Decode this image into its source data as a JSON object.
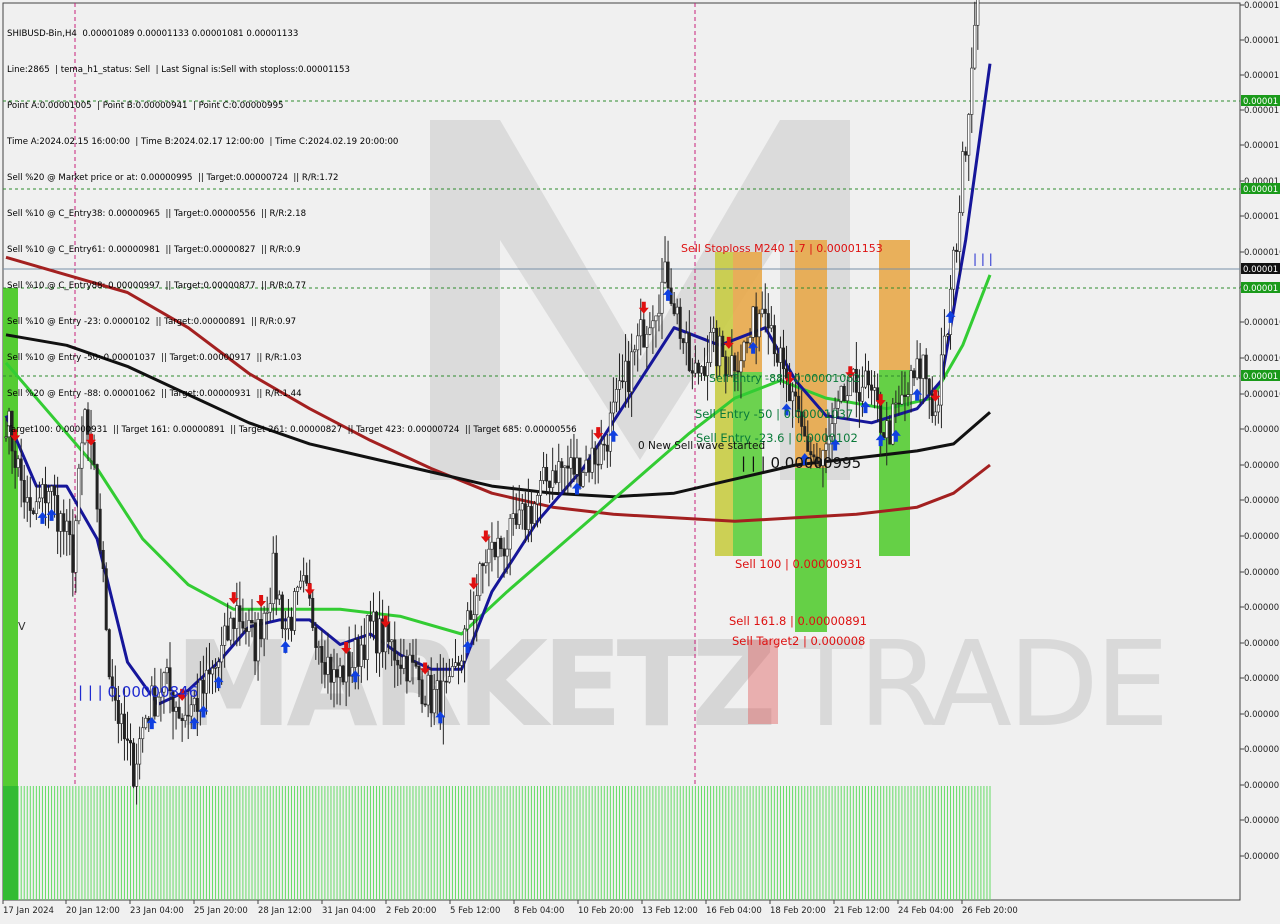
{
  "info_lines": [
    "SHIBUSD-Bin,H4  0.00001089 0.00001133 0.00001081 0.00001133",
    "Line:2865  | tema_h1_status: Sell  | Last Signal is:Sell with stoploss:0.00001153",
    "Point A:0.00001005  | Point B:0.00000941  | Point C:0.00000995",
    "Time A:2024.02.15 16:00:00  | Time B:2024.02.17 12:00:00  | Time C:2024.02.19 20:00:00",
    "Sell %20 @ Market price or at: 0.00000995  || Target:0.00000724  || R/R:1.72",
    "Sell %10 @ C_Entry38: 0.00000965  || Target:0.00000556  || R/R:2.18",
    "Sell %10 @ C_Entry61: 0.00000981  || Target:0.00000827  || R/R:0.9",
    "Sell %10 @ C_Entry88: 0.00000997  || Target:0.00000877  || R/R:0.77",
    "Sell %10 @ Entry -23: 0.0000102  || Target:0.00000891  || R/R:0.97",
    "Sell %10 @ Entry -50: 0.00001037  || Target:0.00000917  || R/R:1.03",
    "Sell %20 @ Entry -88: 0.00001062  || Target:0.00000931  || R/R:1.44",
    "Target100: 0.00000931  || Target 161: 0.00000891  || Target 261: 0.00000827  || Target 423: 0.00000724  || Target 685: 0.00000556"
  ],
  "watermark": {
    "left": "MARKETZ",
    "right": "TRADE"
  },
  "annotations": [
    {
      "id": "stoploss",
      "text": "Sell Stoploss M240 1.7 | 0.00001153",
      "color": "#dd1111"
    },
    {
      "id": "entry88",
      "text": "Sell Entry -88 | 0.00001062",
      "color": "#0a7a3a"
    },
    {
      "id": "entry50",
      "text": "Sell Entry -50 | 0.00001037",
      "color": "#0a7a3a"
    },
    {
      "id": "entry23",
      "text": "Sell Entry -23.6 | 0.0000102",
      "color": "#0a7a3a"
    },
    {
      "id": "wave",
      "text": "0 New Sell wave started",
      "color": "#111111"
    },
    {
      "id": "pointc",
      "text": "| | | 0.00000995",
      "color": "#111111"
    },
    {
      "id": "sell100",
      "text": "Sell 100 | 0.00000931",
      "color": "#dd1111"
    },
    {
      "id": "sell161",
      "text": "Sell 161.8 | 0.00000891",
      "color": "#dd1111"
    },
    {
      "id": "target2",
      "text": "Sell Target2 | 0.000008",
      "color": "#dd1111"
    },
    {
      "id": "low",
      "text": "| | | 0.00000846",
      "color": "#1f2ad0"
    },
    {
      "id": "stopmark",
      "text": "| | |",
      "color": "#1f2ad0"
    },
    {
      "id": "vmark",
      "text": "V",
      "color": "#333333"
    }
  ],
  "price_labels": [
    "0.00001",
    "0.00001",
    "0.00001",
    "0.00001",
    "0.00001",
    "0.00001",
    "0.00001",
    "0.000010",
    "0.000010",
    "0.000010",
    "0.000010",
    "0.000010",
    "0.00000",
    "0.00000",
    "0.00000",
    "0.00000",
    "0.00000",
    "0.00000",
    "0.00000",
    "0.00000",
    "0.00000",
    "0.00000",
    "0.00000",
    "0.00000",
    "0.00000"
  ],
  "tagged_prices": [
    {
      "text": "0.00001",
      "kind": "green"
    },
    {
      "text": "0.00001",
      "kind": "green"
    },
    {
      "text": "0.00001",
      "kind": "current"
    },
    {
      "text": "0.00001",
      "kind": "green"
    },
    {
      "text": "0.00001",
      "kind": "green"
    }
  ],
  "chart_data": {
    "type": "candlestick",
    "symbol": "SHIBUSD-Bin",
    "timeframe": "H4",
    "time_labels": [
      "17 Jan 2024",
      "20 Jan 12:00",
      "23 Jan 04:00",
      "25 Jan 20:00",
      "28 Jan 12:00",
      "31 Jan 04:00",
      "2 Feb 20:00",
      "5 Feb 12:00",
      "8 Feb 04:00",
      "10 Feb 20:00",
      "13 Feb 12:00",
      "16 Feb 04:00",
      "18 Feb 20:00",
      "21 Feb 12:00",
      "24 Feb 04:00",
      "26 Feb 20:00"
    ],
    "ylim": [
      8.1e-06,
      1.21e-05
    ],
    "last": {
      "open": 1.089e-05,
      "high": 1.133e-05,
      "low": 1.081e-05,
      "close": 1.133e-05
    },
    "key_levels": {
      "stoploss": 1.153e-05,
      "entry_88": 1.062e-05,
      "entry_50": 1.037e-05,
      "entry_23_6": 1.02e-05,
      "point_c": 9.95e-06,
      "sell_100": 9.31e-06,
      "sell_161_8": 8.91e-06,
      "target2": 8e-06,
      "swing_low": 8.46e-06
    },
    "price_anchors": [
      [
        0,
        9.6e-06
      ],
      [
        8,
        9.3e-06
      ],
      [
        14,
        9.4e-06
      ],
      [
        22,
        9.2e-06
      ],
      [
        26,
        9.6e-06
      ],
      [
        30,
        9.35e-06
      ],
      [
        34,
        8.9e-06
      ],
      [
        38,
        8.7e-06
      ],
      [
        42,
        8.6e-06
      ],
      [
        46,
        8.75e-06
      ],
      [
        52,
        8.85e-06
      ],
      [
        58,
        8.75e-06
      ],
      [
        64,
        8.8e-06
      ],
      [
        70,
        8.9e-06
      ],
      [
        76,
        9.05e-06
      ],
      [
        82,
        8.95e-06
      ],
      [
        88,
        9.15e-06
      ],
      [
        92,
        9e-06
      ],
      [
        98,
        9.1e-06
      ],
      [
        104,
        8.95e-06
      ],
      [
        108,
        8.85e-06
      ],
      [
        114,
        8.9e-06
      ],
      [
        120,
        9e-06
      ],
      [
        126,
        8.95e-06
      ],
      [
        132,
        8.9e-06
      ],
      [
        140,
        8.8e-06
      ],
      [
        146,
        8.8e-06
      ],
      [
        152,
        9e-06
      ],
      [
        158,
        9.2e-06
      ],
      [
        166,
        9.25e-06
      ],
      [
        174,
        9.35e-06
      ],
      [
        180,
        9.45e-06
      ],
      [
        188,
        9.45e-06
      ],
      [
        196,
        9.5e-06
      ],
      [
        200,
        9.6e-06
      ],
      [
        206,
        9.75e-06
      ],
      [
        212,
        9.9e-06
      ],
      [
        218,
        1e-05
      ],
      [
        226,
        9.7e-06
      ],
      [
        232,
        9.8e-06
      ],
      [
        238,
        9.75e-06
      ],
      [
        244,
        9.8e-06
      ],
      [
        250,
        9.95e-06
      ],
      [
        256,
        9.7e-06
      ],
      [
        262,
        9.55e-06
      ],
      [
        268,
        9.45e-06
      ],
      [
        276,
        9.65e-06
      ],
      [
        282,
        9.7e-06
      ],
      [
        290,
        9.55e-06
      ],
      [
        296,
        9.65e-06
      ],
      [
        302,
        9.75e-06
      ],
      [
        306,
        9.6e-06
      ],
      [
        310,
        9.85e-06
      ],
      [
        314,
        1.02e-05
      ],
      [
        318,
        1.06e-05
      ],
      [
        321,
        1.11e-05
      ],
      [
        324,
        1.133e-05
      ]
    ],
    "moving_averages": [
      {
        "color": "#a32020",
        "points": [
          [
            0,
            1.005e-05
          ],
          [
            20,
            1e-05
          ],
          [
            40,
            9.95e-06
          ],
          [
            60,
            9.85e-06
          ],
          [
            80,
            9.72e-06
          ],
          [
            100,
            9.62e-06
          ],
          [
            120,
            9.53e-06
          ],
          [
            140,
            9.45e-06
          ],
          [
            160,
            9.38e-06
          ],
          [
            180,
            9.34e-06
          ],
          [
            200,
            9.32e-06
          ],
          [
            220,
            9.31e-06
          ],
          [
            240,
            9.3e-06
          ],
          [
            260,
            9.31e-06
          ],
          [
            280,
            9.32e-06
          ],
          [
            300,
            9.34e-06
          ],
          [
            312,
            9.38e-06
          ],
          [
            324,
            9.46e-06
          ]
        ]
      },
      {
        "color": "#111111",
        "points": [
          [
            0,
            9.83e-06
          ],
          [
            20,
            9.8e-06
          ],
          [
            40,
            9.74e-06
          ],
          [
            60,
            9.66e-06
          ],
          [
            80,
            9.58e-06
          ],
          [
            100,
            9.52e-06
          ],
          [
            120,
            9.48e-06
          ],
          [
            140,
            9.44e-06
          ],
          [
            160,
            9.4e-06
          ],
          [
            180,
            9.38e-06
          ],
          [
            200,
            9.37e-06
          ],
          [
            220,
            9.38e-06
          ],
          [
            240,
            9.42e-06
          ],
          [
            260,
            9.46e-06
          ],
          [
            280,
            9.48e-06
          ],
          [
            300,
            9.5e-06
          ],
          [
            312,
            9.52e-06
          ],
          [
            324,
            9.61e-06
          ]
        ]
      },
      {
        "color": "#33cc33",
        "points": [
          [
            0,
            9.75e-06
          ],
          [
            15,
            9.6e-06
          ],
          [
            30,
            9.45e-06
          ],
          [
            45,
            9.25e-06
          ],
          [
            60,
            9.12e-06
          ],
          [
            75,
            9.05e-06
          ],
          [
            90,
            9.05e-06
          ],
          [
            110,
            9.05e-06
          ],
          [
            130,
            9.03e-06
          ],
          [
            150,
            8.98e-06
          ],
          [
            165,
            9.1e-06
          ],
          [
            185,
            9.25e-06
          ],
          [
            205,
            9.4e-06
          ],
          [
            225,
            9.55e-06
          ],
          [
            240,
            9.65e-06
          ],
          [
            255,
            9.7e-06
          ],
          [
            270,
            9.65e-06
          ],
          [
            290,
            9.62e-06
          ],
          [
            305,
            9.65e-06
          ],
          [
            315,
            9.8e-06
          ],
          [
            324,
            1e-05
          ]
        ]
      },
      {
        "color": "#16169a",
        "points": [
          [
            0,
            9.6e-06
          ],
          [
            10,
            9.4e-06
          ],
          [
            20,
            9.4e-06
          ],
          [
            30,
            9.25e-06
          ],
          [
            40,
            8.9e-06
          ],
          [
            50,
            8.78e-06
          ],
          [
            60,
            8.82e-06
          ],
          [
            70,
            8.9e-06
          ],
          [
            80,
            9e-06
          ],
          [
            90,
            9.02e-06
          ],
          [
            100,
            9.02e-06
          ],
          [
            110,
            8.95e-06
          ],
          [
            120,
            8.98e-06
          ],
          [
            130,
            8.92e-06
          ],
          [
            140,
            8.88e-06
          ],
          [
            150,
            8.88e-06
          ],
          [
            160,
            9.1e-06
          ],
          [
            175,
            9.3e-06
          ],
          [
            190,
            9.45e-06
          ],
          [
            205,
            9.65e-06
          ],
          [
            220,
            9.85e-06
          ],
          [
            235,
            9.8e-06
          ],
          [
            250,
            9.85e-06
          ],
          [
            260,
            9.7e-06
          ],
          [
            270,
            9.6e-06
          ],
          [
            285,
            9.58e-06
          ],
          [
            300,
            9.62e-06
          ],
          [
            308,
            9.7e-06
          ],
          [
            316,
            1.01e-05
          ],
          [
            324,
            1.06e-05
          ]
        ]
      }
    ]
  }
}
